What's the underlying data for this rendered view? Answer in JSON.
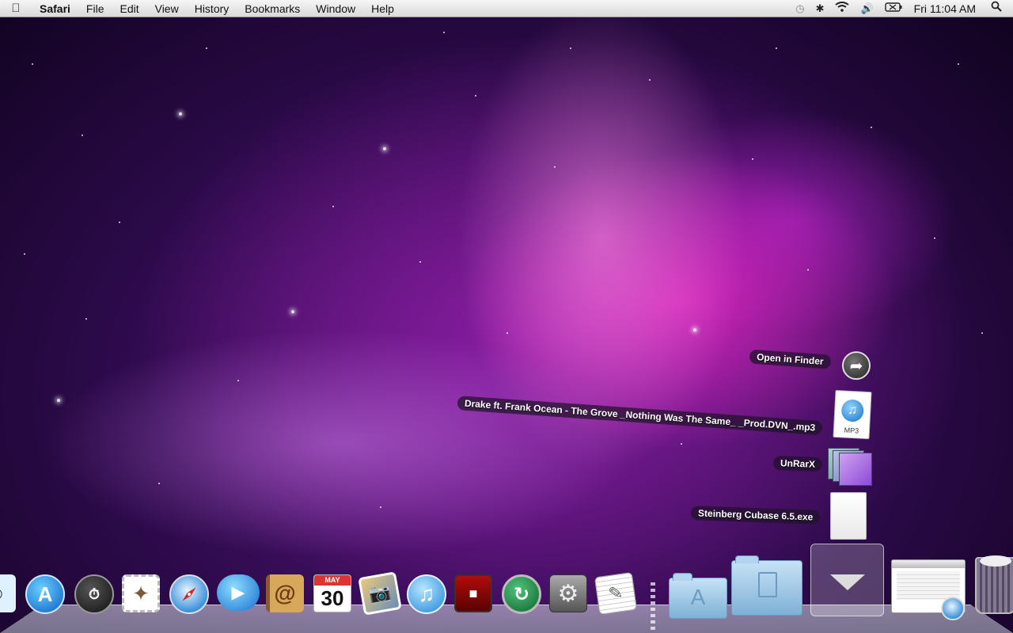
{
  "menubar": {
    "app_name": "Safari",
    "menus": [
      "File",
      "Edit",
      "View",
      "History",
      "Bookmarks",
      "Window",
      "Help"
    ],
    "clock": "Fri 11:04 AM",
    "status_icons": [
      "time-machine-icon",
      "bluetooth-icon",
      "wifi-icon",
      "volume-icon",
      "battery-icon",
      "spotlight-icon"
    ]
  },
  "stack": {
    "open_in_finder": "Open in Finder",
    "items": [
      {
        "label": "Drake ft. Frank Ocean - The Grove _Nothing Was The Same_ _Prod.DVN_.mp3",
        "badge": "MP3"
      },
      {
        "label": "UnRarX"
      },
      {
        "label": "Steinberg Cubase 6.5.exe"
      }
    ]
  },
  "dock": {
    "calendar_month": "MAY",
    "calendar_day": "30",
    "apps": [
      "Finder",
      "App Store",
      "Dashboard",
      "Mail",
      "Safari",
      "FaceTime",
      "Address Book",
      "iCal",
      "iPhoto",
      "iTunes",
      "Front Row",
      "Time Machine",
      "System Preferences",
      "TextEdit"
    ]
  }
}
